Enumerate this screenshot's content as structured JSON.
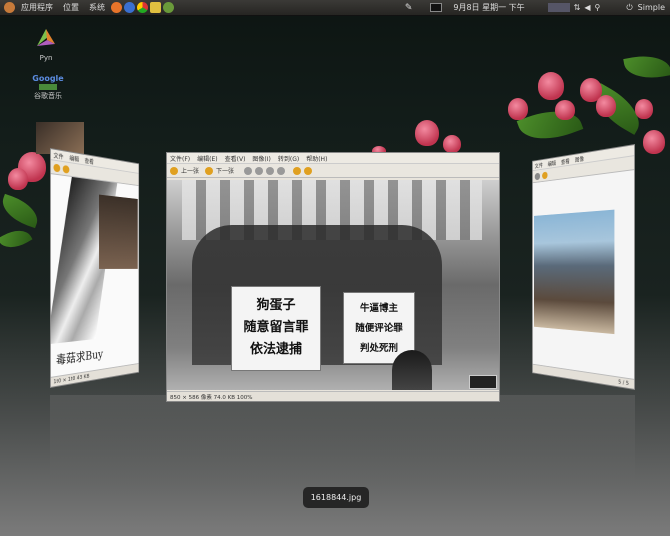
{
  "top_panel": {
    "menus": [
      "应用程序",
      "位置",
      "系统"
    ],
    "clock": "9月8日 星期一 下午",
    "user": "Simple"
  },
  "desktop_icons": [
    {
      "label": "Pyn",
      "icon": "pyn-icon"
    },
    {
      "label": "谷歌音乐",
      "icon": "google-music-icon"
    }
  ],
  "center_window": {
    "menu": [
      "文件(F)",
      "编辑(E)",
      "查看(V)",
      "图像(I)",
      "转到(G)",
      "帮助(H)"
    ],
    "toolbar": {
      "prev": "上一张",
      "next": "下一张"
    },
    "status": "850 × 586 像素 74.0 KB 100%",
    "sign_left": [
      "狗蛋子",
      "随意留言罪",
      "依法逮捕"
    ],
    "sign_right": [
      "牛逼博主",
      "随便评论罪",
      "判处死刑"
    ]
  },
  "left_window": {
    "caption": "毒菇求Buy",
    "status": "1t0 × 1t0 43 KB"
  },
  "right_window": {
    "status": "5 / 5"
  },
  "tooltip": {
    "filename": "1618844.jpg"
  }
}
